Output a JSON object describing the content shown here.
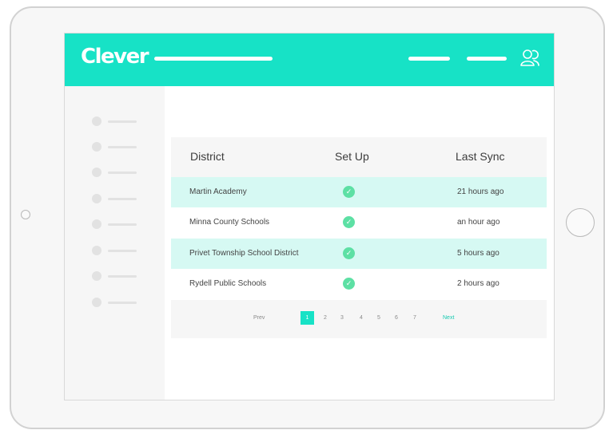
{
  "header": {
    "logo": "Clever",
    "user_icon": "user-icon"
  },
  "sidebar": {
    "items": 8
  },
  "table": {
    "columns": [
      "District",
      "Set Up",
      "Last Sync"
    ],
    "rows": [
      {
        "district": "Martin Academy",
        "setup_icon": "check-icon",
        "setup_glyph": "✓",
        "last_sync": "21 hours ago"
      },
      {
        "district": "Minna County Schools",
        "setup_icon": "check-icon",
        "setup_glyph": "✓",
        "last_sync": "an hour ago"
      },
      {
        "district": "Privet Township School District",
        "setup_icon": "check-icon",
        "setup_glyph": "✓",
        "last_sync": "5 hours ago"
      },
      {
        "district": "Rydell Public Schools",
        "setup_icon": "check-icon",
        "setup_glyph": "✓",
        "last_sync": "2 hours ago"
      }
    ]
  },
  "pagination": {
    "prev_label": "Prev",
    "next_label": "Next",
    "pages": [
      "1",
      "2",
      "3",
      "4",
      "5",
      "6",
      "7"
    ],
    "current": "1"
  },
  "colors": {
    "brand": "#17e2c6",
    "row_highlight": "#d6f9f3",
    "success": "#5de0a4",
    "sidebar_bg": "#f6f6f6"
  }
}
